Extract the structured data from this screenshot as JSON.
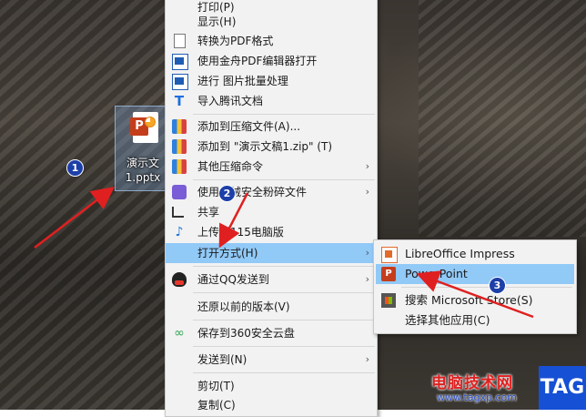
{
  "desktop_icon": {
    "label_line1": "演示文",
    "label_line2": "1.pptx",
    "icon": "powerpoint-file-icon",
    "glyph": "P"
  },
  "context_menu": {
    "items": [
      {
        "label": "打印(P)",
        "icon": ""
      },
      {
        "label": "显示(H)",
        "icon": ""
      },
      {
        "label": "转换为PDF格式",
        "icon": "document-icon"
      },
      {
        "label": "使用金舟PDF编辑器打开",
        "icon": "pdf-editor-icon"
      },
      {
        "label": "进行 图片批量处理",
        "icon": "image-batch-icon"
      },
      {
        "label": "导入腾讯文档",
        "icon": "tencent-docs-icon",
        "glyph": "T"
      },
      {
        "label": "添加到压缩文件(A)...",
        "icon": "archive-icon"
      },
      {
        "label": "添加到 \"演示文稿1.zip\" (T)",
        "icon": "archive-icon"
      },
      {
        "label": "其他压缩命令",
        "icon": "archive-icon",
        "submenu": true
      },
      {
        "label": "使用火绒安全粉碎文件",
        "icon": "shredder-icon",
        "submenu": true
      },
      {
        "label": "共享",
        "icon": "share-icon"
      },
      {
        "label": "上传到115电脑版",
        "icon": "upload-115-icon"
      },
      {
        "label": "打开方式(H)",
        "icon": "",
        "submenu": true,
        "highlighted": true
      },
      {
        "label": "通过QQ发送到",
        "icon": "qq-icon",
        "submenu": true
      },
      {
        "label": "还原以前的版本(V)",
        "icon": ""
      },
      {
        "label": "保存到360安全云盘",
        "icon": "cloud-icon"
      },
      {
        "label": "发送到(N)",
        "icon": "",
        "submenu": true
      },
      {
        "label": "剪切(T)",
        "icon": ""
      },
      {
        "label": "复制(C)",
        "icon": ""
      }
    ],
    "submenu_arrow": "›"
  },
  "open_with_submenu": {
    "items": [
      {
        "label": "LibreOffice Impress",
        "icon": "libreoffice-impress-icon"
      },
      {
        "label": "PowerPoint",
        "icon": "powerpoint-icon",
        "glyph": "P",
        "highlighted": true
      },
      {
        "label": "搜索 Microsoft Store(S)",
        "icon": "microsoft-store-icon"
      },
      {
        "label": "选择其他应用(C)",
        "icon": ""
      }
    ]
  },
  "annotations": {
    "badge1": "1",
    "badge2": "2",
    "badge3": "3",
    "arrow_color": "#e02020",
    "badge_color": "#1c3fa8"
  },
  "watermark": {
    "title": "电脑技术网",
    "url": "www.tagxp.com",
    "tag": "TAG"
  },
  "colors": {
    "menu_bg": "#f2f2f2",
    "highlight": "#91c9f7",
    "ppt_red": "#c43e1c"
  }
}
